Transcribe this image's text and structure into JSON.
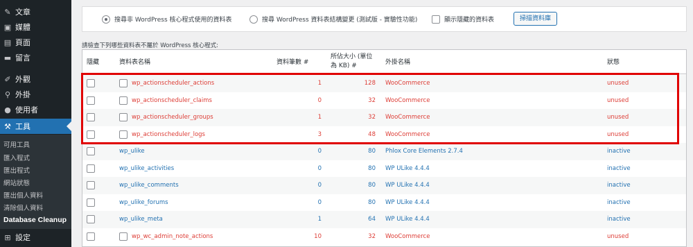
{
  "sidebar": {
    "items": [
      {
        "label": "文章",
        "icon": "pin-icon"
      },
      {
        "label": "媒體",
        "icon": "media-icon"
      },
      {
        "label": "頁面",
        "icon": "page-icon"
      },
      {
        "label": "留言",
        "icon": "comment-icon"
      },
      {
        "label": "外觀",
        "icon": "brush-icon"
      },
      {
        "label": "外掛",
        "icon": "plugin-icon"
      },
      {
        "label": "使用者",
        "icon": "user-icon"
      },
      {
        "label": "工具",
        "icon": "wrench-icon"
      }
    ],
    "submenu": [
      "可用工具",
      "匯入程式",
      "匯出程式",
      "網站狀態",
      "匯出個人資料",
      "清除個人資料"
    ],
    "current_sub": "Database Cleanup",
    "settings": {
      "label": "設定",
      "icon": "settings-icon"
    }
  },
  "options": {
    "radio1": "搜尋非 WordPress 核心程式使用的資料表",
    "radio2": "搜尋 WordPress 資料表結構變更 (測試版 - 實驗性功能)",
    "checkbox": "顯示隱藏的資料表",
    "scan_button": "掃描資料庫"
  },
  "intro": "請檢查下列哪些資料表不屬於 WordPress 核心程式:",
  "table": {
    "headers": {
      "hide": "隱藏",
      "name": "資料表名稱",
      "rows": "資料筆數 #",
      "size_line1": "所佔大小 (單位",
      "size_line2": "為 KB) #",
      "plugin": "外掛名稱",
      "status": "狀態"
    },
    "rows": [
      {
        "name": "wp_actionscheduler_actions",
        "rows": "1",
        "size": "128",
        "plugin": "WooCommerce",
        "status": "unused",
        "color": "red",
        "has_inner_cb": true
      },
      {
        "name": "wp_actionscheduler_claims",
        "rows": "0",
        "size": "32",
        "plugin": "WooCommerce",
        "status": "unused",
        "color": "red",
        "has_inner_cb": true
      },
      {
        "name": "wp_actionscheduler_groups",
        "rows": "1",
        "size": "32",
        "plugin": "WooCommerce",
        "status": "unused",
        "color": "red",
        "has_inner_cb": true
      },
      {
        "name": "wp_actionscheduler_logs",
        "rows": "3",
        "size": "48",
        "plugin": "WooCommerce",
        "status": "unused",
        "color": "red",
        "has_inner_cb": true
      },
      {
        "name": "wp_ulike",
        "rows": "0",
        "size": "80",
        "plugin": "Phlox Core Elements 2.7.4",
        "status": "inactive",
        "color": "blue",
        "has_inner_cb": false
      },
      {
        "name": "wp_ulike_activities",
        "rows": "0",
        "size": "80",
        "plugin": "WP ULike 4.4.4",
        "status": "inactive",
        "color": "blue",
        "has_inner_cb": false
      },
      {
        "name": "wp_ulike_comments",
        "rows": "0",
        "size": "80",
        "plugin": "WP ULike 4.4.4",
        "status": "inactive",
        "color": "blue",
        "has_inner_cb": false
      },
      {
        "name": "wp_ulike_forums",
        "rows": "0",
        "size": "80",
        "plugin": "WP ULike 4.4.4",
        "status": "inactive",
        "color": "blue",
        "has_inner_cb": false
      },
      {
        "name": "wp_ulike_meta",
        "rows": "1",
        "size": "64",
        "plugin": "WP ULike 4.4.4",
        "status": "inactive",
        "color": "blue",
        "has_inner_cb": false
      },
      {
        "name": "wp_wc_admin_note_actions",
        "rows": "10",
        "size": "32",
        "plugin": "WooCommerce",
        "status": "unused",
        "color": "red",
        "has_inner_cb": true
      }
    ]
  },
  "colors": {
    "accent": "#2271b1",
    "unused": "#dd3d36",
    "highlight": "#e00000",
    "sidebar": "#1d2327"
  }
}
